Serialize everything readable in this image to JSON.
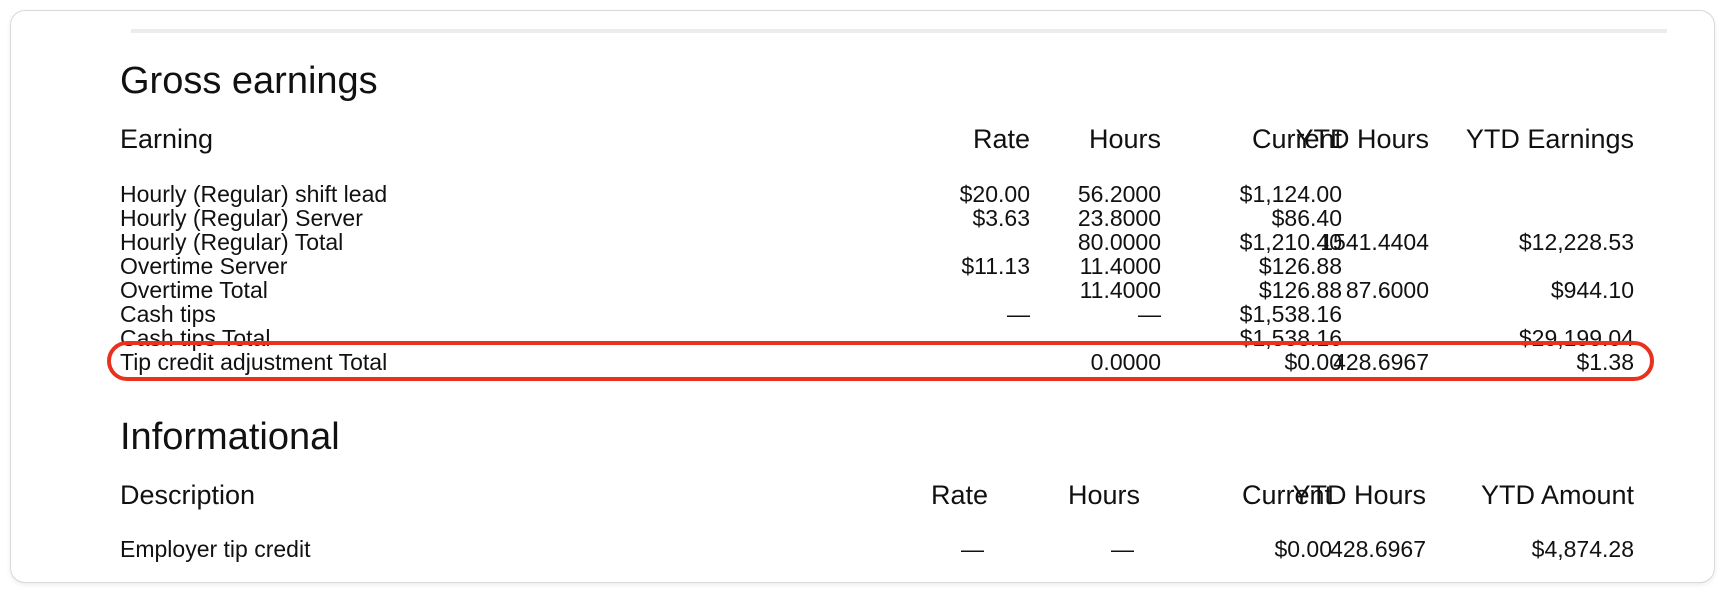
{
  "gross": {
    "title": "Gross earnings",
    "headers": [
      "Earning",
      "Rate",
      "Hours",
      "Current",
      "YTD Hours",
      "YTD Earnings"
    ],
    "rows": [
      {
        "earning": "Hourly (Regular) shift lead",
        "rate": "$20.00",
        "hours": "56.2000",
        "current": "$1,124.00",
        "ytd_hours": "",
        "ytd_earnings": ""
      },
      {
        "earning": "Hourly (Regular) Server",
        "rate": "$3.63",
        "hours": "23.8000",
        "current": "$86.40",
        "ytd_hours": "",
        "ytd_earnings": ""
      },
      {
        "earning": "Hourly (Regular) Total",
        "rate": "",
        "hours": "80.0000",
        "current": "$1,210.40",
        "ytd_hours": "1541.4404",
        "ytd_earnings": "$12,228.53"
      },
      {
        "earning": "Overtime Server",
        "rate": "$11.13",
        "hours": "11.4000",
        "current": "$126.88",
        "ytd_hours": "",
        "ytd_earnings": ""
      },
      {
        "earning": "Overtime Total",
        "rate": "",
        "hours": "11.4000",
        "current": "$126.88",
        "ytd_hours": "87.6000",
        "ytd_earnings": "$944.10"
      },
      {
        "earning": "Cash tips",
        "rate": "—",
        "hours": "—",
        "current": "$1,538.16",
        "ytd_hours": "",
        "ytd_earnings": ""
      },
      {
        "earning": "Cash tips Total",
        "rate": "",
        "hours": "",
        "current": "$1,538.16",
        "ytd_hours": "",
        "ytd_earnings": "$29,199.04"
      },
      {
        "earning": "Tip credit adjustment Total",
        "rate": "",
        "hours": "0.0000",
        "current": "$0.00",
        "ytd_hours": "428.6967",
        "ytd_earnings": "$1.38"
      }
    ]
  },
  "informational": {
    "title": "Informational",
    "headers": [
      "Description",
      "Rate",
      "Hours",
      "Current",
      "YTD Hours",
      "YTD Amount"
    ],
    "rows": [
      {
        "description": "Employer tip credit",
        "rate": "—",
        "hours": "—",
        "current": "$0.00",
        "ytd_hours": "428.6967",
        "ytd_amount": "$4,874.28"
      }
    ]
  },
  "highlight_color": "#e8321d"
}
